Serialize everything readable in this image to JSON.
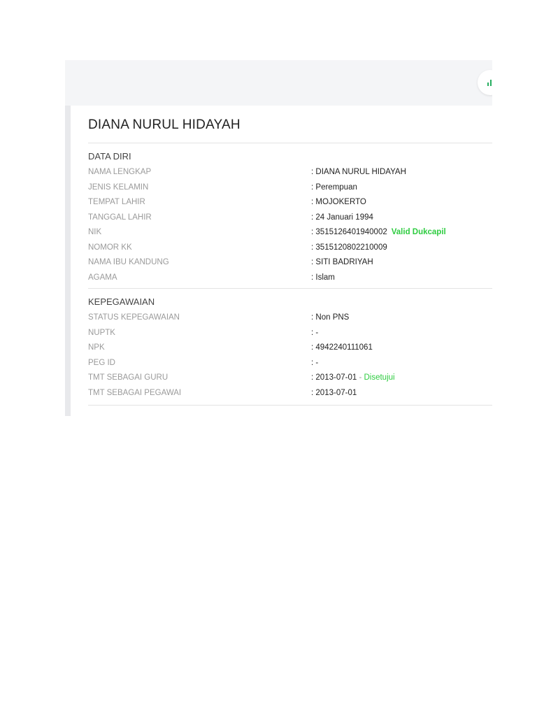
{
  "profile": {
    "name": "DIANA NURUL HIDAYAH"
  },
  "data_diri": {
    "title": "DATA DIRI",
    "rows": [
      {
        "label": "NAMA LENGKAP",
        "value": "DIANA NURUL HIDAYAH"
      },
      {
        "label": "JENIS KELAMIN",
        "value": "Perempuan"
      },
      {
        "label": "TEMPAT LAHIR",
        "value": "MOJOKERTO"
      },
      {
        "label": "TANGGAL LAHIR",
        "value": "24 Januari 1994"
      },
      {
        "label": "NIK",
        "value": "3515126401940002",
        "badge": "Valid Dukcapil"
      },
      {
        "label": "NOMOR KK",
        "value": "3515120802210009"
      },
      {
        "label": "NAMA IBU KANDUNG",
        "value": "SITI BADRIYAH"
      },
      {
        "label": "AGAMA",
        "value": "Islam"
      }
    ]
  },
  "kepegawaian": {
    "title": "KEPEGAWAIAN",
    "rows": [
      {
        "label": "STATUS KEPEGAWAIAN",
        "value": "Non PNS"
      },
      {
        "label": "NUPTK",
        "value": "-"
      },
      {
        "label": "NPK",
        "value": "4942240111061"
      },
      {
        "label": "PEG ID",
        "value": "-"
      },
      {
        "label": "TMT SEBAGAI GURU",
        "value": "2013-07-01",
        "separator": "-",
        "status": "Disetujui"
      },
      {
        "label": "TMT SEBAGAI PEGAWAI",
        "value": "2013-07-01"
      }
    ]
  },
  "colon": ":",
  "icons": {
    "topbar_button": "bar-chart-icon"
  },
  "colors": {
    "accent_green": "#2ecc40",
    "topbar_bg": "#f4f5f7"
  }
}
